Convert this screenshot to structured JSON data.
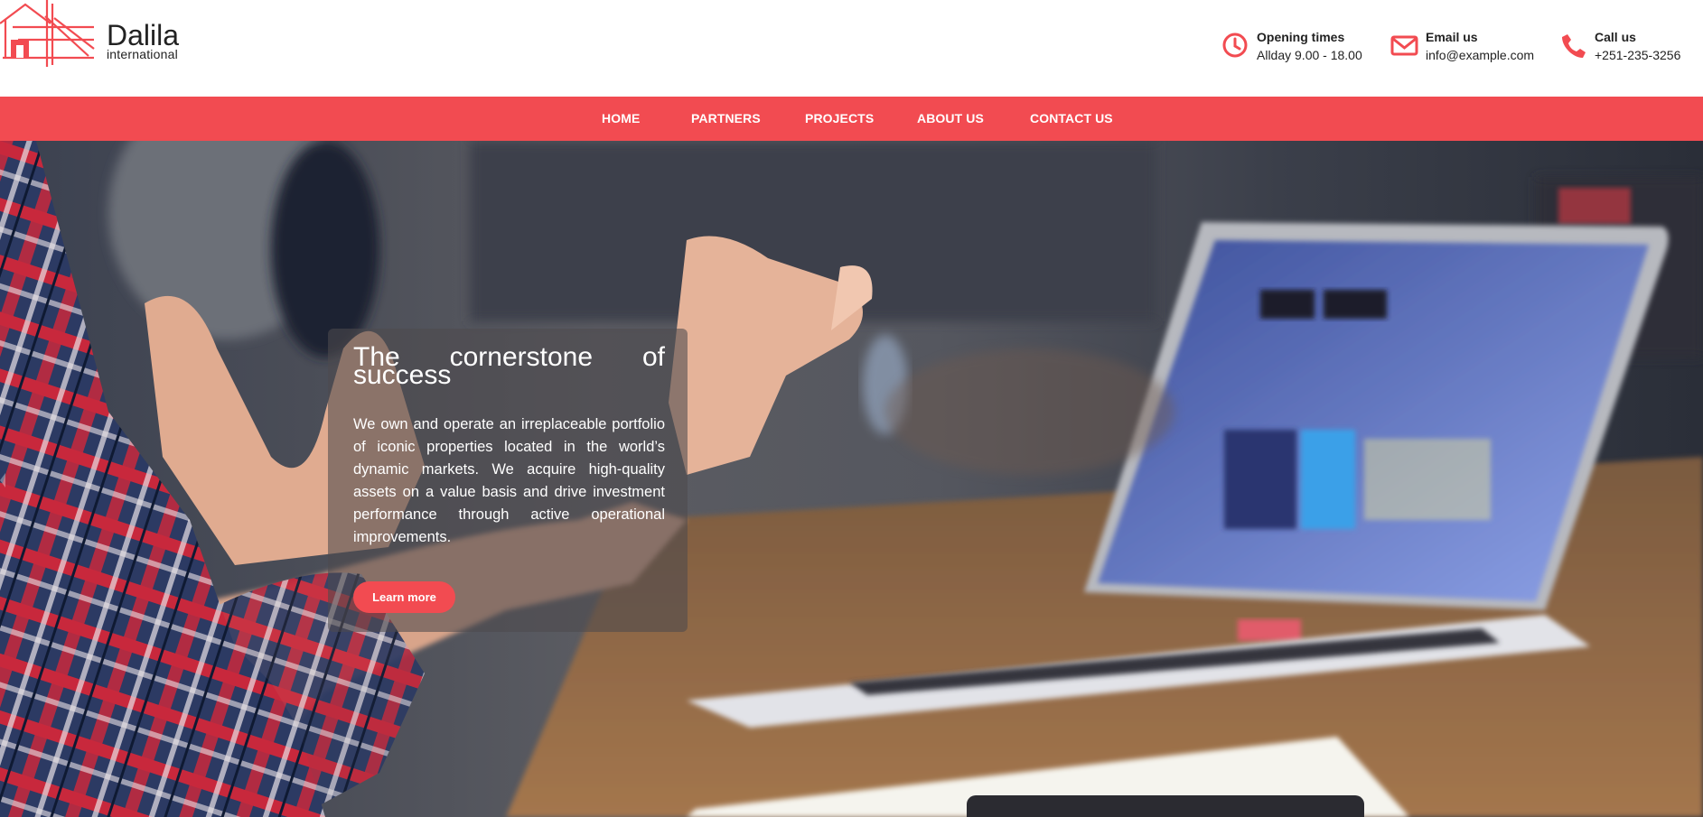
{
  "brand": {
    "name": "Dalila",
    "tagline": "international",
    "accent_color": "#f24b51"
  },
  "contacts": [
    {
      "icon": "clock-icon",
      "title": "Opening times",
      "value": "Allday 9.00 - 18.00"
    },
    {
      "icon": "envelope-icon",
      "title": "Email us",
      "value": "info@example.com"
    },
    {
      "icon": "phone-icon",
      "title": "Call us",
      "value": "+251-235-3256"
    }
  ],
  "nav": {
    "items": [
      {
        "label": "HOME"
      },
      {
        "label": "PARTNERS"
      },
      {
        "label": "PROJECTS"
      },
      {
        "label": "ABOUT US"
      },
      {
        "label": "CONTACT US"
      }
    ]
  },
  "hero": {
    "title_line1": "The cornerstone of",
    "title_line2": "success",
    "body": "We own and operate an irreplaceable portfolio of iconic properties located in the world’s dynamic markets. We acquire high-quality assets on a value basis and drive investment performance through active operational improvements.",
    "button_label": "Learn more"
  }
}
